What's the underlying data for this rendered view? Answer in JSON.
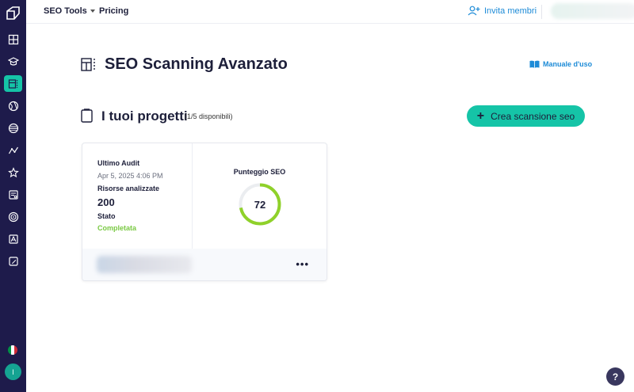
{
  "topbar": {
    "seo_tools": "SEO Tools",
    "pricing": "Pricing",
    "invite": "Invita membri"
  },
  "page": {
    "title": "SEO Scanning Avanzato",
    "manual": "Manuale d'uso"
  },
  "projects": {
    "title": "I tuoi progetti",
    "count": "(1/5 disponibili)",
    "create_button": "Crea scansione seo"
  },
  "card": {
    "last_audit_label": "Ultimo Audit",
    "last_audit_value": "Apr 5, 2025 4:06 PM",
    "resources_label": "Risorse analizzate",
    "resources_value": "200",
    "status_label": "Stato",
    "status_value": "Completata",
    "score_label": "Punteggio SEO",
    "score_value": "72",
    "score_fraction": 0.72,
    "menu_dots": "•••"
  },
  "sidebar": {
    "avatar_initial": "I",
    "items": [
      "dashboard-icon",
      "graduation-icon",
      "seo-scan-icon",
      "globe-icon",
      "link-icon",
      "analytics-icon",
      "star-icon",
      "report-icon",
      "target-icon",
      "content-icon",
      "edit-icon"
    ]
  },
  "help": "?",
  "colors": {
    "sidebar": "#1e1b4b",
    "accent": "#15c4a7",
    "link": "#1d8bd7",
    "success": "#7ac943"
  }
}
